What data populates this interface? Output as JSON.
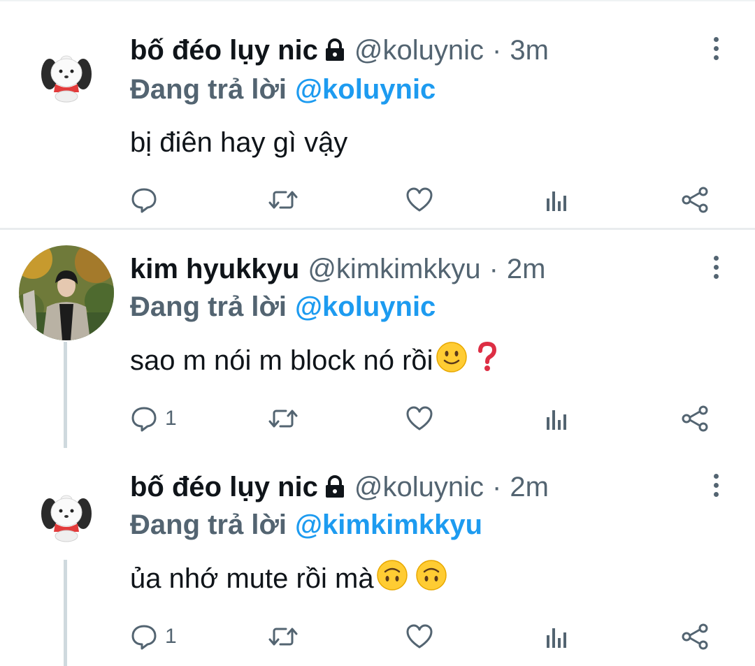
{
  "colors": {
    "accent": "#1d9bf0",
    "secondary": "#536471",
    "text": "#0f1419",
    "divider": "#cfd9de"
  },
  "tweets": [
    {
      "avatar": "pochacco-avatar",
      "name": "bố đéo lụy nic",
      "protected": true,
      "handle": "@koluynic",
      "separator": "·",
      "time": "3m",
      "replying_label": "Đang trả lời",
      "replying_to": "@koluynic",
      "text": "bị điên hay gì vậy",
      "emojis": [],
      "reply_count": "",
      "icons": [
        "reply-icon",
        "retweet-icon",
        "like-icon",
        "analytics-icon",
        "share-icon",
        "more-icon"
      ]
    },
    {
      "avatar": "photo-avatar",
      "name": "kim hyukkyu",
      "protected": false,
      "handle": "@kimkimkkyu",
      "separator": "·",
      "time": "2m",
      "replying_label": "Đang trả lời",
      "replying_to": "@koluynic",
      "text": "sao m nói m block nó rồi",
      "emojis": [
        "slightly-smiling-face-emoji",
        "red-question-mark-emoji"
      ],
      "reply_count": "1",
      "icons": [
        "reply-icon",
        "retweet-icon",
        "like-icon",
        "analytics-icon",
        "share-icon",
        "more-icon"
      ]
    },
    {
      "avatar": "pochacco-avatar",
      "name": "bố đéo lụy nic",
      "protected": true,
      "handle": "@koluynic",
      "separator": "·",
      "time": "2m",
      "replying_label": "Đang trả lời",
      "replying_to": "@kimkimkkyu",
      "text": "ủa nhớ mute rồi mà",
      "emojis": [
        "upside-down-face-emoji",
        "upside-down-face-emoji"
      ],
      "reply_count": "1",
      "icons": [
        "reply-icon",
        "retweet-icon",
        "like-icon",
        "analytics-icon",
        "share-icon",
        "more-icon"
      ]
    }
  ]
}
